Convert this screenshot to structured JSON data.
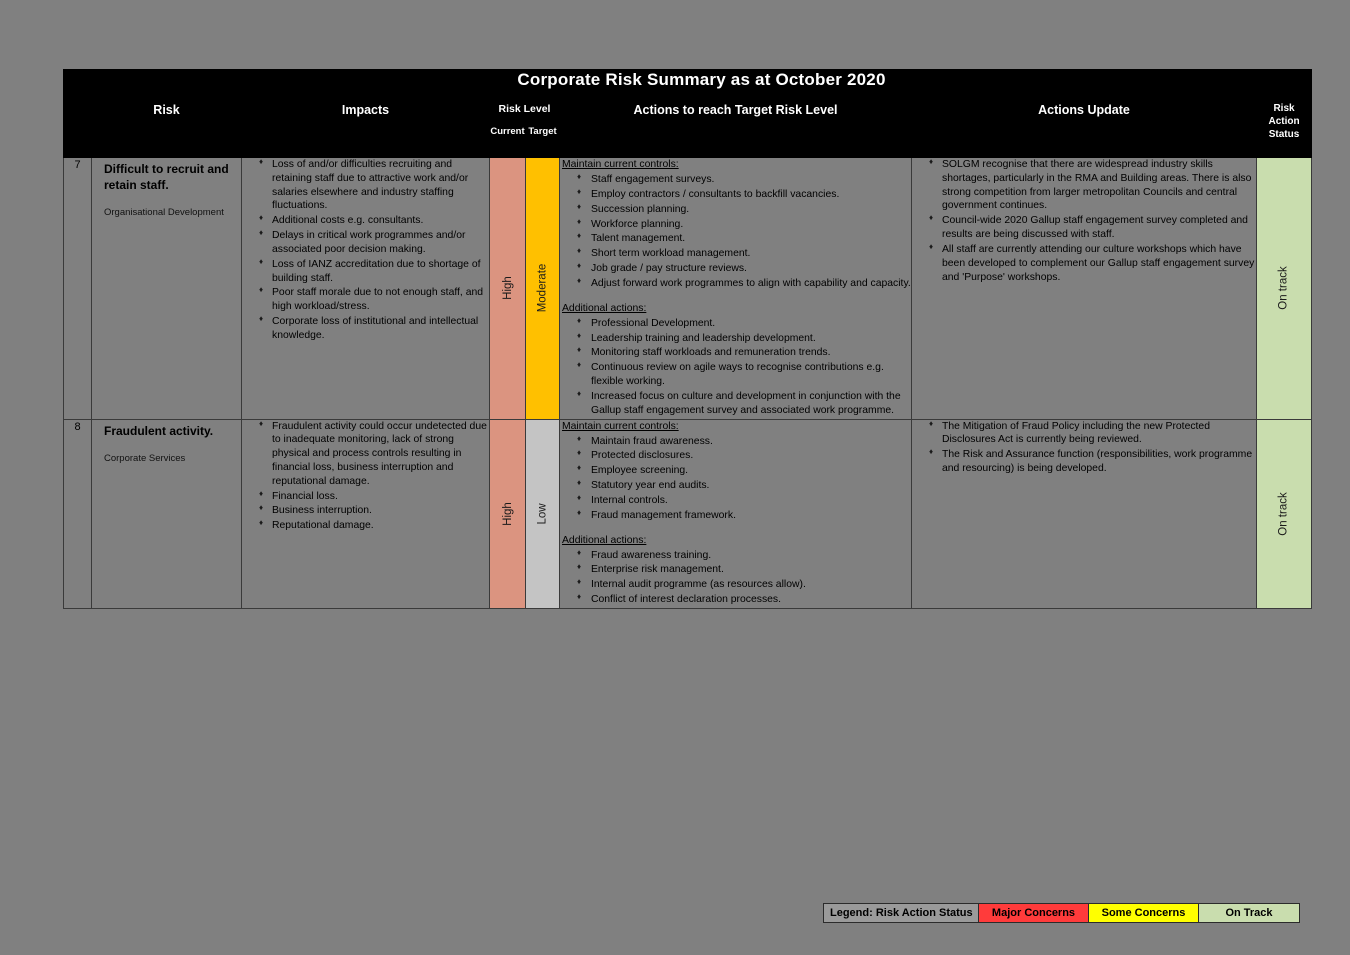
{
  "document": {
    "title": "Corporate Risk Summary as at October 2020"
  },
  "table": {
    "headers": {
      "num": "",
      "risk": "Risk",
      "impacts": "Impacts",
      "risk_level": "Risk Level",
      "current": "Current",
      "target": "Target",
      "actions": "Actions to reach Target Risk Level",
      "actions_update": "Actions Update",
      "status_line1": "Risk",
      "status_line2": "Action",
      "status_line3": "Status"
    },
    "rows": [
      {
        "number": "7",
        "risk_title": "Difficult to recruit and retain staff.",
        "risk_owner": "Organisational Development",
        "impacts": [
          "Loss of and/or difficulties recruiting and retaining staff due to attractive work and/or salaries elsewhere and industry staffing fluctuations.",
          "Additional costs e.g. consultants.",
          "Delays in critical work programmes and/or associated poor decision making.",
          "Loss of IANZ accreditation due to shortage of building staff.",
          "Poor staff morale due to not enough staff, and high workload/stress.",
          "Corporate loss of institutional and intellectual knowledge."
        ],
        "current_level": "High",
        "target_level": "Moderate",
        "actions_groups": [
          {
            "heading": "Maintain current controls:",
            "items": [
              "Staff engagement surveys.",
              "Employ contractors / consultants to backfill vacancies.",
              "Succession planning.",
              "Workforce planning.",
              "Talent management.",
              "Short term workload management.",
              "Job grade / pay structure reviews.",
              "Adjust forward work programmes to align with capability and capacity."
            ]
          },
          {
            "heading": "Additional actions:",
            "items": [
              "Professional Development.",
              "Leadership training and leadership development.",
              "Monitoring staff workloads and remuneration trends.",
              "Continuous review on agile ways to recognise contributions e.g. flexible working.",
              "Increased focus on culture and development in conjunction with the Gallup staff engagement survey and associated work programme."
            ]
          }
        ],
        "updates": [
          "SOLGM recognise that there are widespread industry skills shortages, particularly in the RMA and Building areas. There is also strong competition from larger metropolitan Councils and central government continues.",
          "Council-wide 2020 Gallup staff engagement survey completed and results are being discussed with staff.",
          "All staff are currently attending our culture workshops which have been developed to complement our Gallup staff engagement survey and 'Purpose' workshops."
        ],
        "status": "On track"
      },
      {
        "number": "8",
        "risk_title": "Fraudulent activity.",
        "risk_owner": "Corporate Services",
        "impacts": [
          "Fraudulent activity could occur undetected due to inadequate monitoring, lack of strong physical and process controls resulting in financial loss, business interruption and reputational damage.",
          "Financial loss.",
          "Business interruption.",
          "Reputational damage."
        ],
        "current_level": "High",
        "target_level": "Low",
        "actions_groups": [
          {
            "heading": "Maintain current controls:",
            "items": [
              "Maintain fraud awareness.",
              "Protected disclosures.",
              "Employee screening.",
              "Statutory year end audits.",
              "Internal controls.",
              "Fraud management framework."
            ]
          },
          {
            "heading": "Additional actions:",
            "items": [
              "Fraud awareness training.",
              "Enterprise risk management.",
              "Internal audit programme (as resources allow).",
              "Conflict of interest declaration processes."
            ]
          }
        ],
        "updates": [
          "The Mitigation of Fraud Policy including the new Protected Disclosures Act is currently being reviewed.",
          "The Risk and Assurance function (responsibilities, work programme and resourcing) is being developed."
        ],
        "status": "On track"
      }
    ]
  },
  "legend": {
    "title": "Legend: Risk Action Status",
    "items": [
      {
        "label": "Major Concerns",
        "color": "#FF3B3B"
      },
      {
        "label": "Some Concerns",
        "color": "#FFFF00"
      },
      {
        "label": "On Track",
        "color": "#C9DDAE"
      }
    ]
  },
  "colors": {
    "high": "#DB9480",
    "moderate": "#FFC000",
    "low": "#C4C4C4",
    "on_track": "#C9DDAE",
    "page_background": "#808080",
    "header_background": "#000000"
  }
}
